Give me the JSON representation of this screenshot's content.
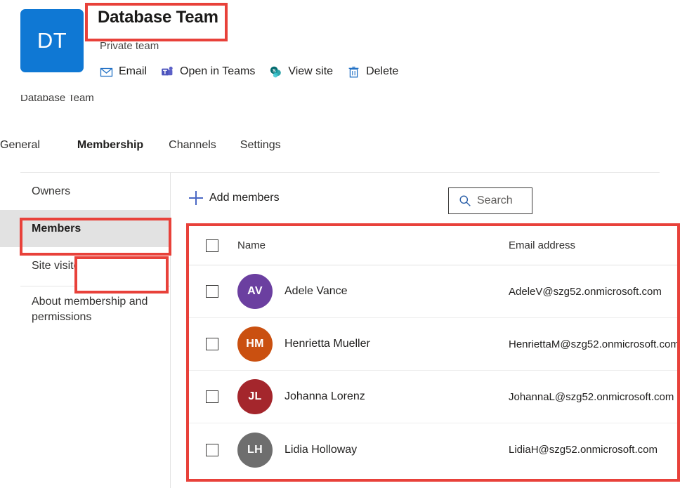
{
  "header": {
    "logo_initials": "DT",
    "logo_color": "#0f78d4",
    "title": "Database Team",
    "privacy": "Private team",
    "subtitle": "Database Team",
    "commands": [
      {
        "id": "email",
        "label": "Email",
        "icon": "envelope-icon"
      },
      {
        "id": "open-in-teams",
        "label": "Open in Teams",
        "icon": "teams-icon"
      },
      {
        "id": "view-site",
        "label": "View site",
        "icon": "sharepoint-icon"
      },
      {
        "id": "delete",
        "label": "Delete",
        "icon": "trash-icon"
      }
    ]
  },
  "tabs": [
    {
      "id": "general",
      "label": "General",
      "selected": false
    },
    {
      "id": "membership",
      "label": "Membership",
      "selected": true
    },
    {
      "id": "channels",
      "label": "Channels",
      "selected": false
    },
    {
      "id": "settings",
      "label": "Settings",
      "selected": false
    }
  ],
  "sidebar": {
    "items": [
      {
        "id": "owners",
        "label": "Owners",
        "selected": false
      },
      {
        "id": "members",
        "label": "Members",
        "selected": true
      },
      {
        "id": "site-visitors",
        "label": "Site visitors",
        "selected": false
      }
    ],
    "about": "About membership and permissions"
  },
  "toolbar": {
    "add_members_label": "Add members",
    "search_placeholder": "Search"
  },
  "table": {
    "columns": {
      "name": "Name",
      "email": "Email address"
    },
    "rows": [
      {
        "initials": "AV",
        "avatar_color": "#6b3fa0",
        "name": "Adele Vance",
        "email": "AdeleV@szg52.onmicrosoft.com",
        "checked": false
      },
      {
        "initials": "HM",
        "avatar_color": "#ca5010",
        "name": "Henrietta Mueller",
        "email": "HenriettaM@szg52.onmicrosoft.com",
        "checked": false
      },
      {
        "initials": "JL",
        "avatar_color": "#a4262c",
        "name": "Johanna Lorenz",
        "email": "JohannaL@szg52.onmicrosoft.com",
        "checked": false
      },
      {
        "initials": "LH",
        "avatar_color": "#6e6e6e",
        "name": "Lidia Holloway",
        "email": "LidiaH@szg52.onmicrosoft.com",
        "checked": false
      }
    ]
  },
  "annotations": {
    "color": "#e8413a",
    "targets": [
      "team-title",
      "membership-tab",
      "members-sidebar-item",
      "members-table"
    ]
  }
}
